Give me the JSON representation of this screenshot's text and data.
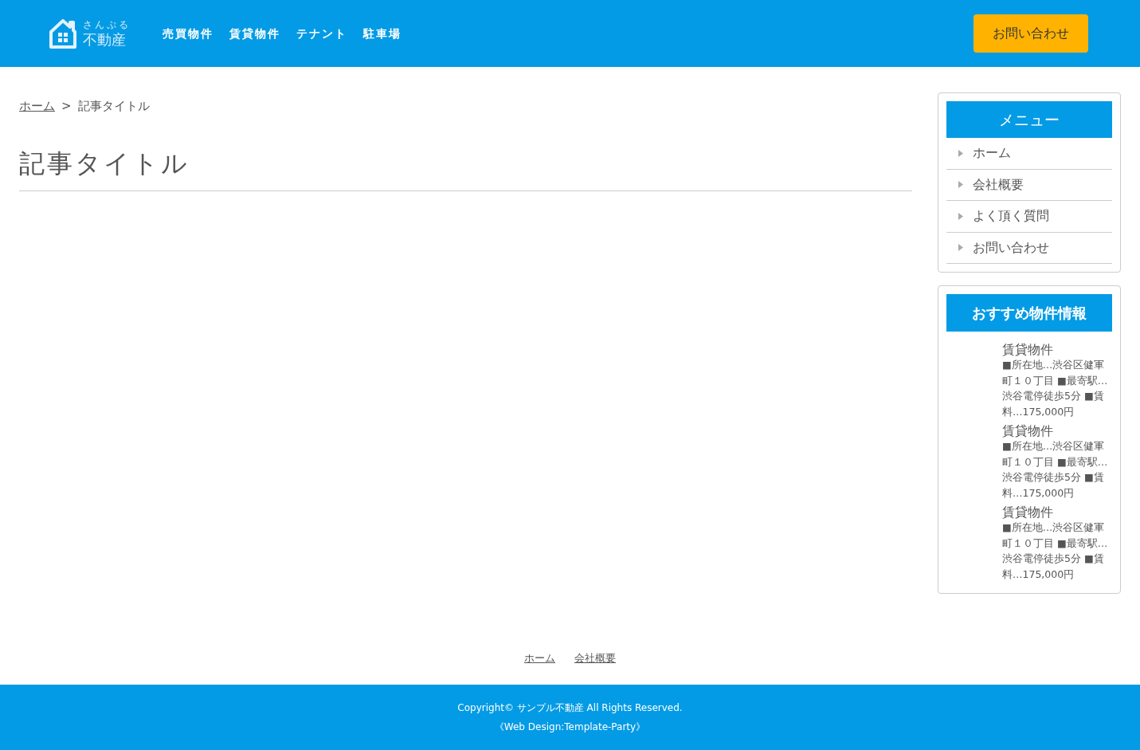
{
  "header": {
    "logo": {
      "small": "さんぷる",
      "large": "不動産"
    },
    "nav": [
      "売買物件",
      "賃貸物件",
      "テナント",
      "駐車場"
    ],
    "contact_button": "お問い合わせ"
  },
  "breadcrumb": {
    "items": [
      "ホーム"
    ],
    "separator": ">",
    "current": "記事タイトル"
  },
  "article": {
    "title": "記事タイトル"
  },
  "sidebar": {
    "menu": {
      "title": "メニュー",
      "items": [
        "ホーム",
        "会社概要",
        "よく頂く質問",
        "お問い合わせ"
      ]
    },
    "recommended": {
      "title": "おすすめ物件情報",
      "items": [
        {
          "title": "賃貸物件",
          "description": "■所在地…渋谷区健軍町１０丁目 ■最寄駅…渋谷電停徒歩5分 ■賃料…175,000円"
        },
        {
          "title": "賃貸物件",
          "description": "■所在地…渋谷区健軍町１０丁目 ■最寄駅…渋谷電停徒歩5分 ■賃料…175,000円"
        },
        {
          "title": "賃貸物件",
          "description": "■所在地…渋谷区健軍町１０丁目 ■最寄駅…渋谷電停徒歩5分 ■賃料…175,000円"
        }
      ]
    }
  },
  "footer_links": [
    "ホーム",
    "会社概要"
  ],
  "footer": {
    "copyright": "Copyright© サンプル不動産 All Rights Reserved.",
    "credit": "《Web Design:Template-Party》"
  }
}
